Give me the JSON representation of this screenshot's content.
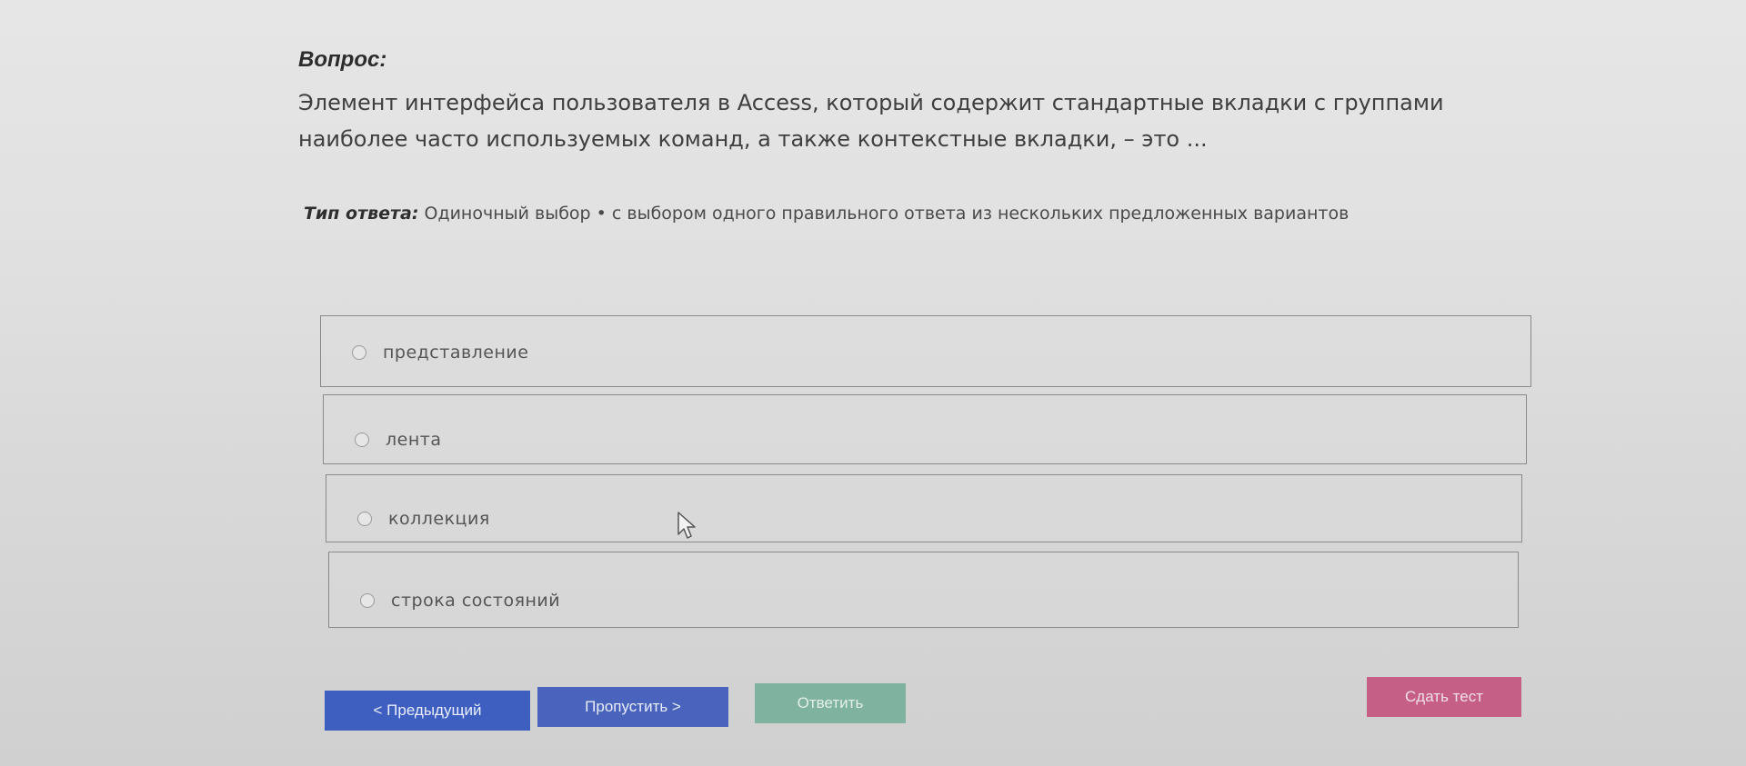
{
  "question": {
    "heading": "Вопрос:",
    "text": "Элемент интерфейса пользователя в Access, который содержит стандартные вкладки с группами наиболее часто используемых команд, а также контекстные вкладки, – это ..."
  },
  "answer_type": {
    "label": "Тип ответа:",
    "value": "Одиночный выбор • с выбором одного правильного ответа из нескольких предложенных вариантов"
  },
  "options": [
    {
      "label": "представление"
    },
    {
      "label": "лента"
    },
    {
      "label": "коллекция"
    },
    {
      "label": "строка состояний"
    }
  ],
  "buttons": {
    "prev": "< Предыдущий",
    "skip": "Пропустить >",
    "answer": "Ответить",
    "submit": "Сдать тест"
  },
  "colors": {
    "prev_button": "#3f5fc0",
    "skip_button": "#4a63bc",
    "answer_button": "#7fb3a0",
    "submit_button": "#c55f86"
  }
}
